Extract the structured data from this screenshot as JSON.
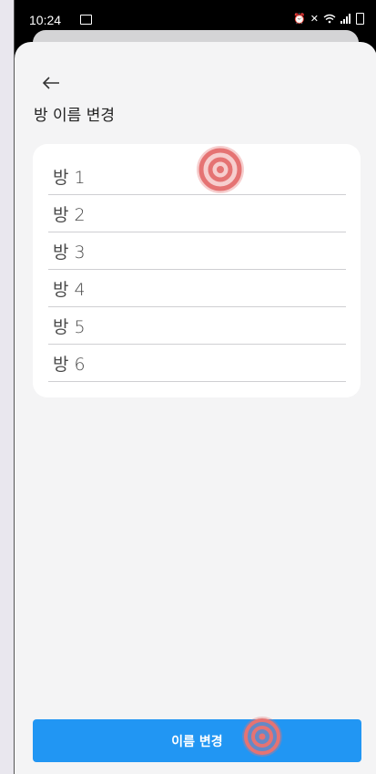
{
  "status_bar": {
    "time": "10:24",
    "icons": [
      "image-icon",
      "alarm-icon",
      "mute-icon",
      "wifi-icon",
      "signal-icon",
      "battery-icon"
    ]
  },
  "header": {
    "back_icon": "arrow-left-icon",
    "title": "방 이름 변경"
  },
  "rooms": [
    {
      "label": "방 1"
    },
    {
      "label": "방 2"
    },
    {
      "label": "방 3"
    },
    {
      "label": "방 4"
    },
    {
      "label": "방 5"
    },
    {
      "label": "방 6"
    }
  ],
  "footer": {
    "rename_button_label": "이름 변경"
  },
  "colors": {
    "accent": "#2196f3",
    "sheet_bg": "#f4f4f5",
    "card_bg": "#ffffff",
    "touch_marker": "#e57373"
  }
}
